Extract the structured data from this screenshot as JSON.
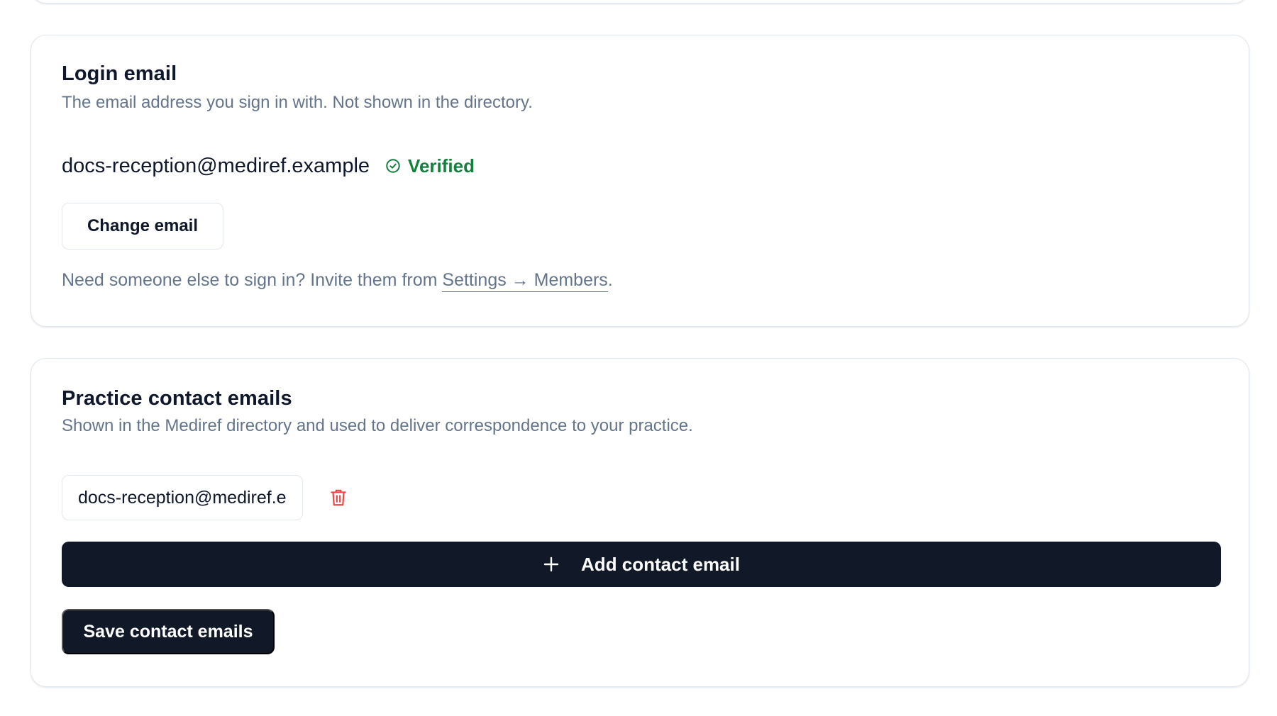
{
  "login_email": {
    "title": "Login email",
    "description": "The email address you sign in with. Not shown in the directory.",
    "email": "docs-reception@mediref.example",
    "verified_icon": "check-circle-icon",
    "verified_label": "Verified",
    "change_button_label": "Change email",
    "invite_note_prefix": "Need someone else to sign in? Invite them from ",
    "invite_link_label": "Settings → Members",
    "invite_note_suffix": "."
  },
  "contact_emails": {
    "title": "Practice contact emails",
    "description": "Shown in the Mediref directory and used to deliver correspondence to your practice.",
    "emails": [
      {
        "value": "docs-reception@mediref.example",
        "delete_icon": "trash-icon"
      }
    ],
    "add_button_icon": "plus-icon",
    "add_button_label": "Add contact email",
    "save_button_label": "Save contact emails"
  },
  "colors": {
    "verified": "#15803d",
    "delete": "#ef4444",
    "primary_button": "#111827",
    "muted_text": "#64748b",
    "border": "#e2e8f0"
  }
}
